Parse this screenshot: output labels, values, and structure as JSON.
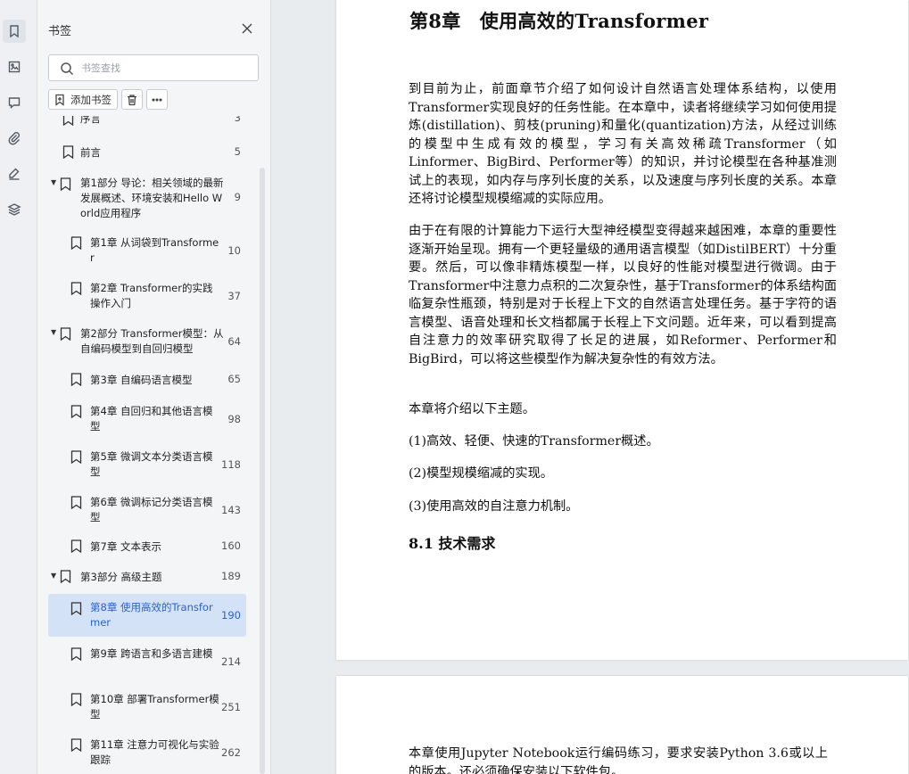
{
  "panel": {
    "title": "书签",
    "search_placeholder": "书签查找",
    "add_bookmark_label": "添加书签"
  },
  "bookmarks": [
    {
      "label": "序言",
      "page": "3",
      "level": 0,
      "expand": false
    },
    {
      "label": "前言",
      "page": "5",
      "level": 0,
      "expand": false
    },
    {
      "label": "第1部分 导论：相关领域的最新发展概述、环境安装和Hello World应用程序",
      "page": "9",
      "level": 0,
      "expand": true
    },
    {
      "label": "第1章 从词袋到Transformer",
      "page": "10",
      "level": 1
    },
    {
      "label": "第2章 Transformer的实践操作入门",
      "page": "37",
      "level": 1
    },
    {
      "label": "第2部分 Transformer模型：从自编码模型到自回归模型",
      "page": "64",
      "level": 0,
      "expand": true
    },
    {
      "label": "第3章 自编码语言模型",
      "page": "65",
      "level": 1
    },
    {
      "label": "第4章 自回归和其他语言模型",
      "page": "98",
      "level": 1
    },
    {
      "label": "第5章 微调文本分类语言模型",
      "page": "118",
      "level": 1
    },
    {
      "label": "第6章 微调标记分类语言模型",
      "page": "143",
      "level": 1
    },
    {
      "label": "第7章 文本表示",
      "page": "160",
      "level": 1
    },
    {
      "label": "第3部分 高级主题",
      "page": "189",
      "level": 0,
      "expand": true
    },
    {
      "label": "第8章 使用高效的Transformer",
      "page": "190",
      "level": 1,
      "selected": true
    },
    {
      "label": "第9章 跨语言和多语言建模",
      "page": "214",
      "level": 1
    },
    {
      "label": "第10章 部署Transformer模型",
      "page": "251",
      "level": 1
    },
    {
      "label": "第11章 注意力可视化与实验跟踪",
      "page": "262",
      "level": 1
    }
  ],
  "document": {
    "chapter_title": "第8章　使用高效的Transformer",
    "para1": "到目前为止，前面章节介绍了如何设计自然语言处理体系结构，以使用Transformer实现良好的任务性能。在本章中，读者将继续学习如何使用提炼(distillation)、剪枝(pruning)和量化(quantization)方法，从经过训练的模型中生成有效的模型，学习有关高效稀疏Transformer（如Linformer、BigBird、Performer等）的知识，并讨论模型在各种基准测试上的表现，如内存与序列长度的关系，以及速度与序列长度的关系。本章还将讨论模型规模缩减的实际应用。",
    "para2": "由于在有限的计算能力下运行大型神经模型变得越来越困难，本章的重要性逐渐开始呈现。拥有一个更轻量级的通用语言模型（如DistilBERT）十分重要。然后，可以像非精炼模型一样，以良好的性能对模型进行微调。由于Transformer中注意力点积的二次复杂性，基于Transformer的体系结构面临复杂性瓶颈，特别是对于长程上下文的自然语言处理任务。基于字符的语言模型、语音处理和长文档都属于长程上下文问题。近年来，可以看到提高自注意力的效率研究取得了长足的进展，如Reformer、Performer和BigBird，可以将这些模型作为解决复杂性的有效方法。",
    "para3": "本章将介绍以下主题。",
    "topic1": "(1)高效、轻便、快速的Transformer概述。",
    "topic2": "(2)模型规模缩减的实现。",
    "topic3": "(3)使用高效的自注意力机制。",
    "section_title": "8.1 技术需求",
    "page2_text": "本章使用Jupyter Notebook运行编码练习，要求安装Python 3.6或以上的版本。还必须确保安装以下软件包。"
  }
}
